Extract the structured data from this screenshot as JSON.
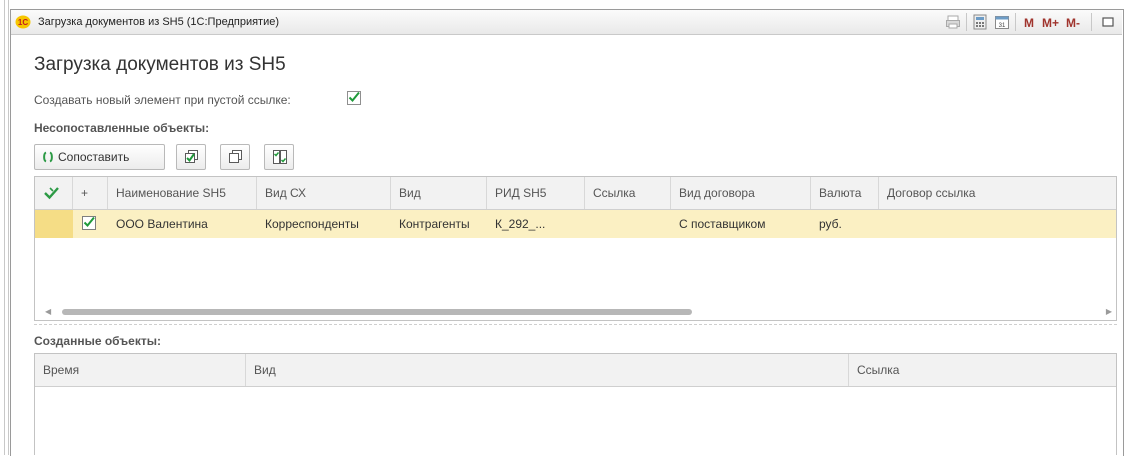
{
  "window": {
    "title": "Загрузка документов из SH5  (1С:Предприятие)",
    "toolbar_labels": {
      "m": "M",
      "m_plus": "M+",
      "m_minus": "M-"
    }
  },
  "form": {
    "title": "Загрузка документов из SH5",
    "create_new_label": "Создавать новый элемент при пустой ссылке:",
    "create_new_checked": true,
    "unmatched_title": "Несопоставленные объекты:",
    "match_button": "Сопоставить",
    "created_title": "Созданные объекты:"
  },
  "unmatched_table": {
    "columns": [
      "",
      "+",
      "Наименование SH5",
      "Вид СХ",
      "Вид",
      "РИД SH5",
      "Ссылка",
      "Вид договора",
      "Валюта",
      "Договор ссылка"
    ],
    "rows": [
      {
        "checked": true,
        "name": "ООО Валентина",
        "vid_sx": "Корреспонденты",
        "vid": "Контрагенты",
        "rid": "К_292_...",
        "link": "",
        "contract_type": "С поставщиком",
        "currency": "руб.",
        "contract_link": ""
      }
    ]
  },
  "created_table": {
    "columns": [
      "Время",
      "Вид",
      "Ссылка"
    ]
  },
  "colors": {
    "row_highlight": "#fbf0c3",
    "accent_red": "#a0342d",
    "check_green": "#1f9a3a"
  }
}
